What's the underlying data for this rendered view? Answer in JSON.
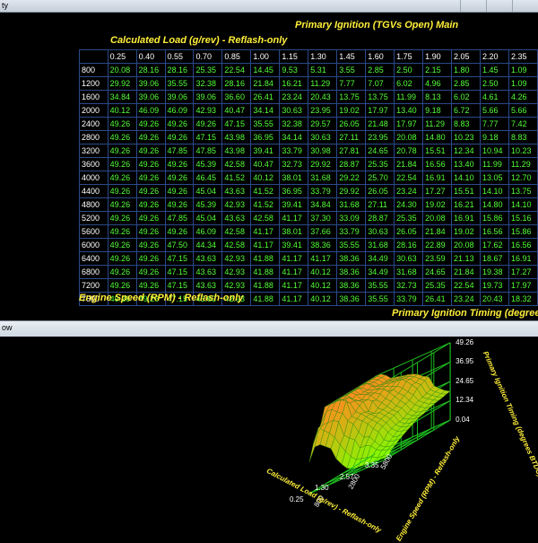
{
  "window": {
    "title": "ty"
  },
  "map": {
    "title": "Primary Ignition (TGVs Open) Main",
    "x_axis_label": "Calculated Load (g/rev) - Reflash-only",
    "y_axis_label": "Engine Speed (RPM) - Reflash-only",
    "z_axis_label": "Primary Ignition Timing (degrees",
    "columns": [
      "0.25",
      "0.40",
      "0.55",
      "0.70",
      "0.85",
      "1.00",
      "1.15",
      "1.30",
      "1.45",
      "1.60",
      "1.75",
      "1.90",
      "2.05",
      "2.20",
      "2.35"
    ],
    "rows": [
      {
        "rpm": "800",
        "values": [
          "20.08",
          "28.16",
          "28.16",
          "25.35",
          "22.54",
          "14.45",
          "9.53",
          "5.31",
          "3.55",
          "2.85",
          "2.50",
          "2.15",
          "1.80",
          "1.45",
          "1.09"
        ]
      },
      {
        "rpm": "1200",
        "values": [
          "29.92",
          "39.06",
          "35.55",
          "32.38",
          "28.16",
          "21.84",
          "16.21",
          "11.29",
          "7.77",
          "7.07",
          "6.02",
          "4.96",
          "2.85",
          "2.50",
          "1.09"
        ]
      },
      {
        "rpm": "1600",
        "values": [
          "34.84",
          "39.06",
          "39.06",
          "39.06",
          "36.60",
          "26.41",
          "23.24",
          "20.43",
          "13.75",
          "13.75",
          "11.99",
          "8.13",
          "6.02",
          "4.61",
          "4.26"
        ]
      },
      {
        "rpm": "2000",
        "values": [
          "40.12",
          "46.09",
          "46.09",
          "42.93",
          "40.47",
          "34.14",
          "30.63",
          "23.95",
          "19.02",
          "17.97",
          "13.40",
          "9.18",
          "6.72",
          "5.66",
          "5.66"
        ]
      },
      {
        "rpm": "2400",
        "values": [
          "49.26",
          "49.26",
          "49.26",
          "49.26",
          "47.15",
          "35.55",
          "32.38",
          "29.57",
          "26.05",
          "21.48",
          "17.97",
          "11.29",
          "8.83",
          "7.77",
          "7.42"
        ]
      },
      {
        "rpm": "2800",
        "values": [
          "49.26",
          "49.26",
          "49.26",
          "47.15",
          "43.98",
          "36.95",
          "34.14",
          "30.63",
          "27.11",
          "23.95",
          "20.08",
          "14.80",
          "10.23",
          "9.18",
          "8.83"
        ]
      },
      {
        "rpm": "3200",
        "values": [
          "49.26",
          "49.26",
          "47.85",
          "47.85",
          "43.98",
          "39.41",
          "33.79",
          "30.98",
          "27.81",
          "24.65",
          "20.78",
          "15.51",
          "12.34",
          "10.94",
          "10.23"
        ]
      },
      {
        "rpm": "3600",
        "values": [
          "49.26",
          "49.26",
          "49.26",
          "45.39",
          "42.58",
          "40.47",
          "32.73",
          "29.92",
          "28.87",
          "25.35",
          "21.84",
          "16.56",
          "13.40",
          "11.99",
          "11.29"
        ]
      },
      {
        "rpm": "4000",
        "values": [
          "49.26",
          "49.26",
          "49.26",
          "46.45",
          "41.52",
          "40.12",
          "38.01",
          "31.68",
          "29.22",
          "25.70",
          "22.54",
          "16.91",
          "14.10",
          "13.05",
          "12.70"
        ]
      },
      {
        "rpm": "4400",
        "values": [
          "49.26",
          "49.26",
          "49.26",
          "45.04",
          "43.63",
          "41.52",
          "36.95",
          "33.79",
          "29.92",
          "26.05",
          "23.24",
          "17.27",
          "15.51",
          "14.10",
          "13.75"
        ]
      },
      {
        "rpm": "4800",
        "values": [
          "49.26",
          "49.26",
          "49.26",
          "45.39",
          "42.93",
          "41.52",
          "39.41",
          "34.84",
          "31.68",
          "27.11",
          "24.30",
          "19.02",
          "16.21",
          "14.80",
          "14.10"
        ]
      },
      {
        "rpm": "5200",
        "values": [
          "49.26",
          "49.26",
          "47.85",
          "45.04",
          "43.63",
          "42.58",
          "41.17",
          "37.30",
          "33.09",
          "28.87",
          "25.35",
          "20.08",
          "16.91",
          "15.86",
          "15.16"
        ]
      },
      {
        "rpm": "5600",
        "values": [
          "49.26",
          "49.26",
          "49.26",
          "46.09",
          "42.58",
          "41.17",
          "38.01",
          "37.66",
          "33.79",
          "30.63",
          "26.05",
          "21.84",
          "19.02",
          "16.56",
          "15.86"
        ]
      },
      {
        "rpm": "6000",
        "values": [
          "49.26",
          "49.26",
          "47.50",
          "44.34",
          "42.58",
          "41.17",
          "39.41",
          "38.36",
          "35.55",
          "31.68",
          "28.16",
          "22.89",
          "20.08",
          "17.62",
          "16.56"
        ]
      },
      {
        "rpm": "6400",
        "values": [
          "49.26",
          "49.26",
          "47.15",
          "43.63",
          "42.93",
          "41.88",
          "41.17",
          "41.17",
          "38.36",
          "34.49",
          "30.63",
          "23.59",
          "21.13",
          "18.67",
          "16.91"
        ]
      },
      {
        "rpm": "6800",
        "values": [
          "49.26",
          "49.26",
          "47.15",
          "43.63",
          "42.93",
          "41.88",
          "41.17",
          "40.12",
          "38.36",
          "34.49",
          "31.68",
          "24.65",
          "21.84",
          "19.38",
          "17.27"
        ]
      },
      {
        "rpm": "7200",
        "values": [
          "49.26",
          "49.26",
          "47.15",
          "43.63",
          "42.93",
          "41.88",
          "41.17",
          "40.12",
          "38.36",
          "35.55",
          "32.73",
          "25.35",
          "22.54",
          "19.73",
          "17.97"
        ]
      },
      {
        "rpm": "7600",
        "values": [
          "49.26",
          "49.26",
          "47.15",
          "43.63",
          "42.93",
          "41.88",
          "41.17",
          "40.12",
          "38.36",
          "35.55",
          "33.79",
          "26.41",
          "23.24",
          "20.43",
          "18.32"
        ]
      }
    ]
  },
  "view3d": {
    "title": "ow",
    "z_ticks": [
      "49.26",
      "36.95",
      "24.65",
      "12.34",
      "0.04"
    ],
    "x_ticks": [
      "0.25",
      "1.30",
      "2.57",
      "3.35"
    ],
    "y_ticks": [
      "800",
      "2800",
      "5800"
    ],
    "z_label": "Primary Ignition Timing (degrees BTDC)",
    "x_label": "Calculated Load (g/rev) - Reflash-only",
    "y_label": "Engine Speed (RPM) - Reflash-only"
  },
  "colors": {
    "cell_text": "#52ff38",
    "header_text": "#ffffff",
    "title_yellow": "#ffef3a",
    "grid_line": "#2a4a8a",
    "surface_hot": "#ff9a1a",
    "surface_cold": "#7cff00"
  }
}
